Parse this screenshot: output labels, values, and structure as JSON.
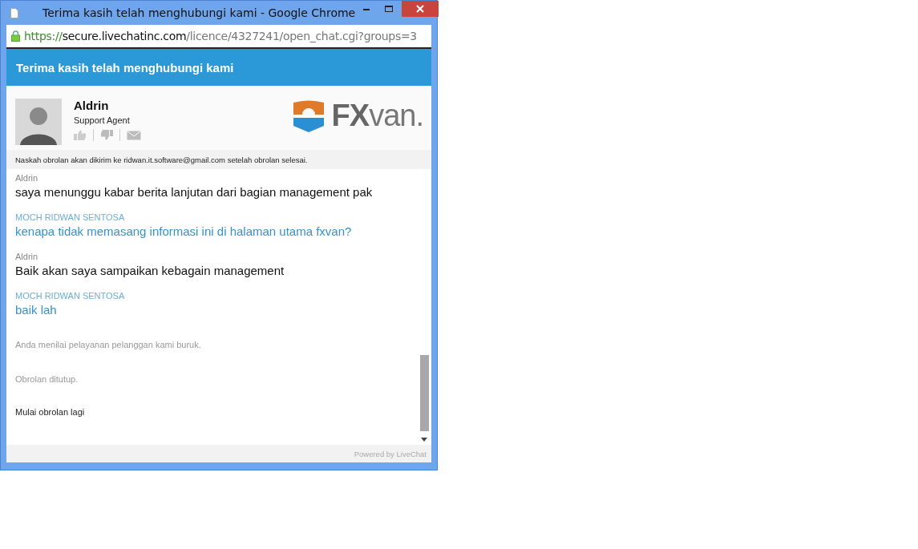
{
  "window": {
    "title": "Terima kasih telah menghubungi kami - Google Chrome"
  },
  "address_bar": {
    "scheme": "https://",
    "host": "secure.livechatinc.com",
    "path": "/licence/4327241/open_chat.cgi?groups=3"
  },
  "header": {
    "title": "Terima kasih telah menghubungi kami"
  },
  "agent": {
    "name": "Aldrin",
    "role": "Support Agent",
    "logo": "**FX**van."
  },
  "notice": "Naskah obrolan akan dikirim ke ridwan.it.software@gmail.com setelah obrolan selesai.",
  "messages": [
    {
      "kind": "agent",
      "author": "Aldrin",
      "text": "saya menunggu kabar berita lanjutan dari bagian management pak"
    },
    {
      "kind": "visitor",
      "author": "MOCH RIDWAN SENTOSA",
      "text": "kenapa tidak memasang informasi ini di halaman utama fxvan?"
    },
    {
      "kind": "agent",
      "author": "Aldrin",
      "text": "Baik akan saya sampaikan kebagain management"
    },
    {
      "kind": "visitor",
      "author": "MOCH RIDWAN SENTOSA",
      "text": "baik lah"
    },
    {
      "kind": "system",
      "text": "Anda menilai pelayanan pelanggan kami buruk."
    },
    {
      "kind": "system",
      "text": "Obrolan ditutup."
    },
    {
      "kind": "action",
      "text": "Mulai obrolan lagi"
    }
  ],
  "footer": {
    "text": "Powered by LiveChat"
  }
}
